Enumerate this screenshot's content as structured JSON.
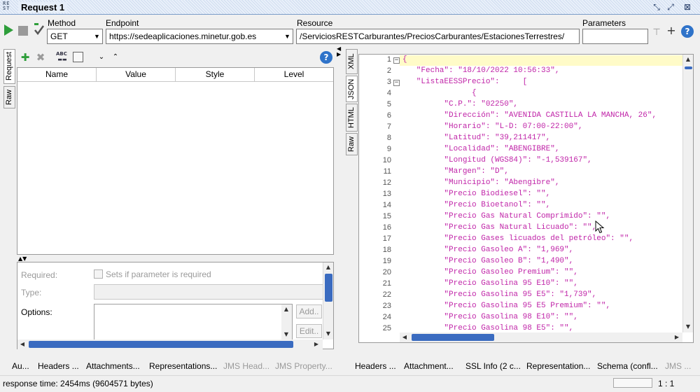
{
  "window": {
    "logo": "RE ST",
    "title": "Request 1"
  },
  "toolbar": {
    "method_label": "Method",
    "method_value": "GET",
    "endpoint_label": "Endpoint",
    "endpoint_value": "https://sedeaplicaciones.minetur.gob.es",
    "resource_label": "Resource",
    "resource_value": "/ServiciosRESTCarburantes/PreciosCarburantes/EstacionesTerrestres/",
    "parameters_label": "Parameters",
    "parameters_value": ""
  },
  "left_panel": {
    "tabs": [
      "Request",
      "Raw"
    ],
    "columns": [
      "Name",
      "Value",
      "Style",
      "Level"
    ],
    "required_label": "Required:",
    "required_checkbox_label": "Sets if parameter is required",
    "type_label": "Type:",
    "options_label": "Options:",
    "add_button": "Add..",
    "edit_button": "Edit..",
    "bottom_tabs": [
      {
        "label": "Au...",
        "enabled": true
      },
      {
        "label": "Headers ...",
        "enabled": true
      },
      {
        "label": "Attachments...",
        "enabled": true
      },
      {
        "label": "Representations...",
        "enabled": true
      },
      {
        "label": "JMS Head...",
        "enabled": false
      },
      {
        "label": "JMS Property...",
        "enabled": false
      }
    ]
  },
  "right_panel": {
    "tabs": [
      "XML",
      "JSON",
      "HTML",
      "Raw"
    ],
    "code_lines": [
      "{",
      "   \"Fecha\": \"18/10/2022 10:56:33\",",
      "   \"ListaEESSPrecio\":     [",
      "               {",
      "         \"C.P.\": \"02250\",",
      "         \"Dirección\": \"AVENIDA CASTILLA LA MANCHA, 26\",",
      "         \"Horario\": \"L-D: 07:00-22:00\",",
      "         \"Latitud\": \"39,211417\",",
      "         \"Localidad\": \"ABENGIBRE\",",
      "         \"Longitud (WGS84)\": \"-1,539167\",",
      "         \"Margen\": \"D\",",
      "         \"Municipio\": \"Abengibre\",",
      "         \"Precio Biodiesel\": \"\",",
      "         \"Precio Bioetanol\": \"\",",
      "         \"Precio Gas Natural Comprimido\": \"\",",
      "         \"Precio Gas Natural Licuado\": \"\",",
      "         \"Precio Gases licuados del petróleo\": \"\",",
      "         \"Precio Gasoleo A\": \"1,969\",",
      "         \"Precio Gasoleo B\": \"1,490\",",
      "         \"Precio Gasoleo Premium\": \"\",",
      "         \"Precio Gasolina 95 E10\": \"\",",
      "         \"Precio Gasolina 95 E5\": \"1,739\",",
      "         \"Precio Gasolina 95 E5 Premium\": \"\",",
      "         \"Precio Gasolina 98 E10\": \"\",",
      "         \"Precio Gasolina 98 E5\": \"\","
    ],
    "bottom_tabs": [
      {
        "label": "Headers ...",
        "enabled": true
      },
      {
        "label": "Attachment...",
        "enabled": true
      },
      {
        "label": "SSL Info (2 c...",
        "enabled": true
      },
      {
        "label": "Representation...",
        "enabled": true
      },
      {
        "label": "Schema (confl...",
        "enabled": true
      },
      {
        "label": "JMS ...",
        "enabled": false
      }
    ]
  },
  "status": {
    "response_time": "response time: 2454ms (9604571 bytes)",
    "position": "1 : 1"
  },
  "colors": {
    "json_text": "#c024a8",
    "current_line": "#fffbc8",
    "accent": "#3a6bc0"
  }
}
